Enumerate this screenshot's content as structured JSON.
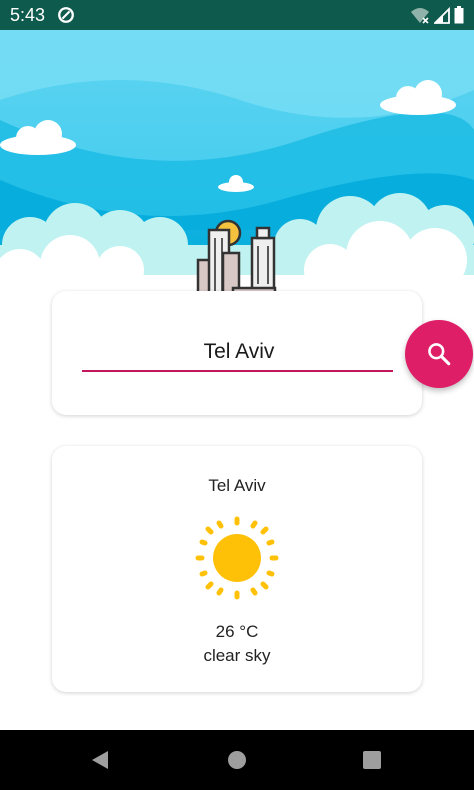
{
  "status_bar": {
    "time": "5:43",
    "icons": [
      "data-saver-icon",
      "wifi-off-icon",
      "signal-icon",
      "battery-icon"
    ]
  },
  "search": {
    "value": "Tel Aviv",
    "button_icon": "search-icon"
  },
  "weather": {
    "city": "Tel Aviv",
    "icon": "sun-icon",
    "temperature": "26 °C",
    "description": "clear sky"
  },
  "colors": {
    "status_bar": "#0e5a4c",
    "accent": "#df1e68",
    "underline": "#c2185b",
    "sun": "#ffc107",
    "sky": "#29c4e8"
  },
  "nav_bar": {
    "icons": [
      "back-icon",
      "home-icon",
      "recents-icon"
    ]
  }
}
